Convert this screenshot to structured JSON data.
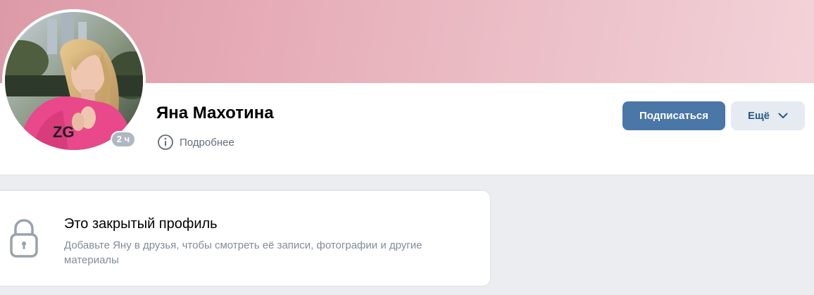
{
  "profile": {
    "name": "Яна Махотина",
    "online_status": "2 ч",
    "details_label": "Подробнее"
  },
  "actions": {
    "subscribe_label": "Подписаться",
    "more_label": "Ещё"
  },
  "closed_profile": {
    "title": "Это закрытый профиль",
    "text": "Добавьте Яну в друзья, чтобы смотреть её записи, фотографии и другие материалы"
  },
  "icons": {
    "info": "info-circle-icon",
    "chevron": "chevron-down-icon",
    "lock": "lock-icon"
  },
  "colors": {
    "accent": "#4a76a8",
    "secondary_button_bg": "#e5ebf1",
    "secondary_button_text": "#2a5885",
    "cover_left": "#dc9aa7",
    "cover_right": "#f2d2d8",
    "page_bg": "#ebedf0"
  }
}
